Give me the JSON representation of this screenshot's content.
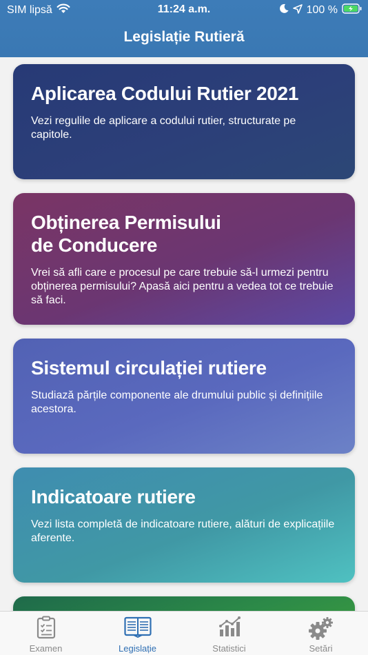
{
  "status_bar": {
    "carrier": "SIM lipsă",
    "time": "11:24 a.m.",
    "battery": "100 %",
    "icons": [
      "wifi-icon",
      "moon-icon",
      "location-arrow-icon",
      "battery-charging-icon"
    ]
  },
  "header": {
    "title": "Legislație Rutieră"
  },
  "cards": [
    {
      "title": "Aplicarea Codului Rutier 2021",
      "description": "Vezi regulile de aplicare a codului rutier, structurate pe capitole."
    },
    {
      "title_line1": "Obținerea Permisului",
      "title_line2": "de Conducere",
      "description": "Vrei să afli care e procesul pe care trebuie să-l urmezi pentru obținerea permisului? Apasă aici pentru a vedea tot ce trebuie să faci."
    },
    {
      "title": "Sistemul circulației rutiere",
      "description": "Studiază părțile componente ale drumului public și definițiile acestora."
    },
    {
      "title": "Indicatoare rutiere",
      "description": "Vezi lista completă de indicatoare rutiere, alături de explicațiile aferente."
    }
  ],
  "tabs": [
    {
      "label": "Examen",
      "icon": "clipboard-checklist-icon",
      "active": false
    },
    {
      "label": "Legislație",
      "icon": "open-book-icon",
      "active": true
    },
    {
      "label": "Statistici",
      "icon": "bar-chart-icon",
      "active": false
    },
    {
      "label": "Setări",
      "icon": "gears-icon",
      "active": false
    }
  ],
  "colors": {
    "header": "#3d7cb8",
    "active_tab": "#2f6fb3",
    "inactive_tab": "#8a8a8a"
  }
}
